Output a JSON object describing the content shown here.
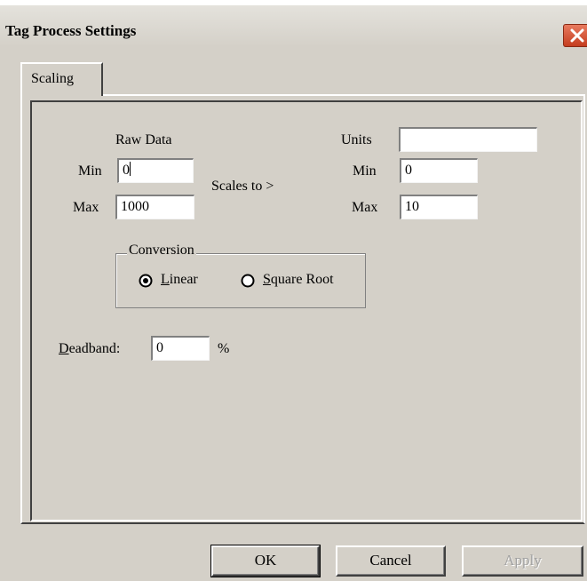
{
  "window": {
    "title": "Tag Process Settings"
  },
  "tabs": [
    {
      "label": "Scaling"
    }
  ],
  "raw": {
    "heading": "Raw Data",
    "min_label": "Min",
    "min_value": "0",
    "max_label": "Max",
    "max_value": "1000"
  },
  "scales_to": "Scales to >",
  "scaled": {
    "units_label": "Units",
    "units_value": "",
    "min_label": "Min",
    "min_value": "0",
    "max_label": "Max",
    "max_value": "10"
  },
  "conversion": {
    "legend": "Conversion",
    "options": [
      {
        "label_key": "L",
        "label_rest": "inear",
        "selected": true
      },
      {
        "label_key": "S",
        "label_rest": "quare Root",
        "selected": false
      }
    ]
  },
  "deadband": {
    "label_key": "D",
    "label_rest": "eadband:",
    "value": "0",
    "unit": "%"
  },
  "buttons": {
    "ok": "OK",
    "cancel": "Cancel",
    "apply": "Apply"
  }
}
